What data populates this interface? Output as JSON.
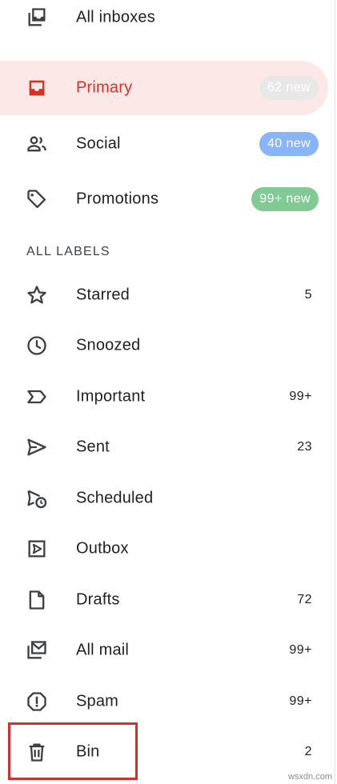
{
  "inboxes": [
    {
      "label": "All inboxes",
      "icon": "all-inboxes-icon"
    },
    {
      "label": "Primary",
      "icon": "inbox-icon",
      "badge": "62 new",
      "badge_color": "#e8e8e8",
      "selected": true
    },
    {
      "label": "Social",
      "icon": "people-icon",
      "badge": "40 new",
      "badge_color": "#8ab4f8"
    },
    {
      "label": "Promotions",
      "icon": "tag-icon",
      "badge": "99+ new",
      "badge_color": "#81c995"
    }
  ],
  "section_header": "ALL LABELS",
  "labels": [
    {
      "label": "Starred",
      "icon": "star-icon",
      "count": "5"
    },
    {
      "label": "Snoozed",
      "icon": "clock-icon",
      "count": ""
    },
    {
      "label": "Important",
      "icon": "important-icon",
      "count": "99+"
    },
    {
      "label": "Sent",
      "icon": "send-icon",
      "count": "23"
    },
    {
      "label": "Scheduled",
      "icon": "scheduled-icon",
      "count": ""
    },
    {
      "label": "Outbox",
      "icon": "outbox-icon",
      "count": ""
    },
    {
      "label": "Drafts",
      "icon": "draft-icon",
      "count": "72"
    },
    {
      "label": "All mail",
      "icon": "all-mail-icon",
      "count": "99+"
    },
    {
      "label": "Spam",
      "icon": "spam-icon",
      "count": "99+"
    },
    {
      "label": "Bin",
      "icon": "trash-icon",
      "count": "2",
      "highlighted": true
    }
  ],
  "colors": {
    "selected_bg": "#fce8e6",
    "selected_text": "#d93025",
    "highlight_border": "#d32f2f"
  },
  "watermark": "wsxdn.com"
}
